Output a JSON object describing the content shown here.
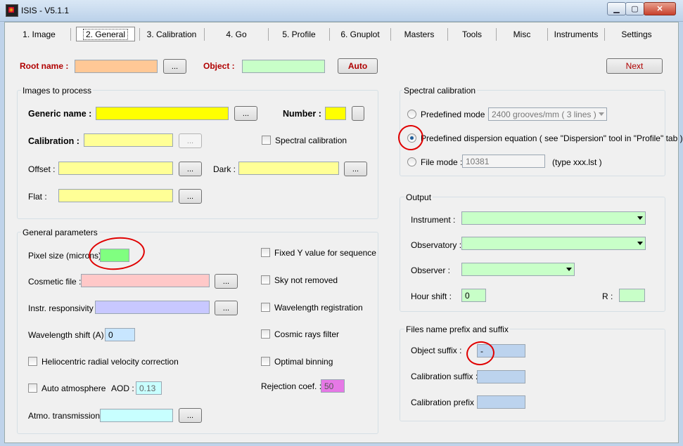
{
  "window": {
    "title": "ISIS - V5.1.1",
    "min_icon": "minimize-icon",
    "max_icon": "maximize-icon",
    "close_icon": "close-icon"
  },
  "tabs": [
    "1. Image",
    "2. General",
    "3. Calibration",
    "4. Go",
    "5. Profile",
    "6. Gnuplot",
    "Masters",
    "Tools",
    "Misc",
    "Instruments",
    "Settings"
  ],
  "selected_tab": "2. General",
  "top": {
    "root_label": "Root name :",
    "root_value": "",
    "browse_label": "...",
    "object_label": "Object :",
    "object_value": "",
    "auto_label": "Auto",
    "next_label": "Next"
  },
  "images": {
    "title": "Images to process",
    "generic_label": "Generic name :",
    "number_label": "Number :",
    "calibration_label": "Calibration :",
    "spectral_calibration_label": "Spectral calibration",
    "offset_label": "Offset :",
    "dark_label": "Dark :",
    "flat_label": "Flat :"
  },
  "general": {
    "title": "General parameters",
    "pixel_size_label": "Pixel size (microns) :",
    "pixel_size_value": "",
    "cosmetic_label": "Cosmetic file :",
    "responsivity_label": "Instr. responsivity :",
    "wl_shift_label": "Wavelength shift (A) :",
    "wl_shift_value": "0",
    "helio_label": "Heliocentric radial velocity correction",
    "auto_atmo_label": "Auto atmosphere",
    "aod_label": "AOD :",
    "aod_value": "0.13",
    "atmo_trans_label": "Atmo. transmission :",
    "fixed_y_label": "Fixed Y value for sequence",
    "sky_label": "Sky not removed",
    "wl_reg_label": "Wavelength registration",
    "cosmic_label": "Cosmic rays filter",
    "optimal_label": "Optimal binning",
    "rejection_label": "Rejection coef. :",
    "rejection_value": "50"
  },
  "spectral": {
    "title": "Spectral calibration",
    "predefined_mode_label": "Predefined mode",
    "grooves_value": "2400 grooves/mm ( 3 lines )",
    "dispersion_label": "Predefined dispersion equation ( see \"Dispersion\" tool in \"Profile\" tab )",
    "file_mode_label": "File mode :",
    "file_mode_value": "10381",
    "file_type_hint": "(type xxx.lst )"
  },
  "output": {
    "title": "Output",
    "instrument_label": "Instrument :",
    "observatory_label": "Observatory :",
    "observer_label": "Observer :",
    "hour_shift_label": "Hour shift :",
    "hour_shift_value": "0",
    "r_label": "R :",
    "r_value": ""
  },
  "prefix": {
    "title": "Files name prefix and suffix",
    "object_suffix_label": "Object suffix :",
    "object_suffix_value": "-",
    "calib_suffix_label": "Calibration suffix :",
    "calib_prefix_label": "Calibration prefix :"
  },
  "colors": {
    "orange": "#ffc896",
    "light_green": "#c8ffc8",
    "bright_green": "#80ff80",
    "yellow": "#ffff00",
    "light_yellow": "#ffff96",
    "pink": "#ffc8c8",
    "lavender": "#c8c8ff",
    "light_blue": "#c8e6ff",
    "cyan": "#c8ffff",
    "magenta": "#e678e6",
    "steel_blue": "#bcd3ee",
    "annotation_red": "#e00000"
  }
}
